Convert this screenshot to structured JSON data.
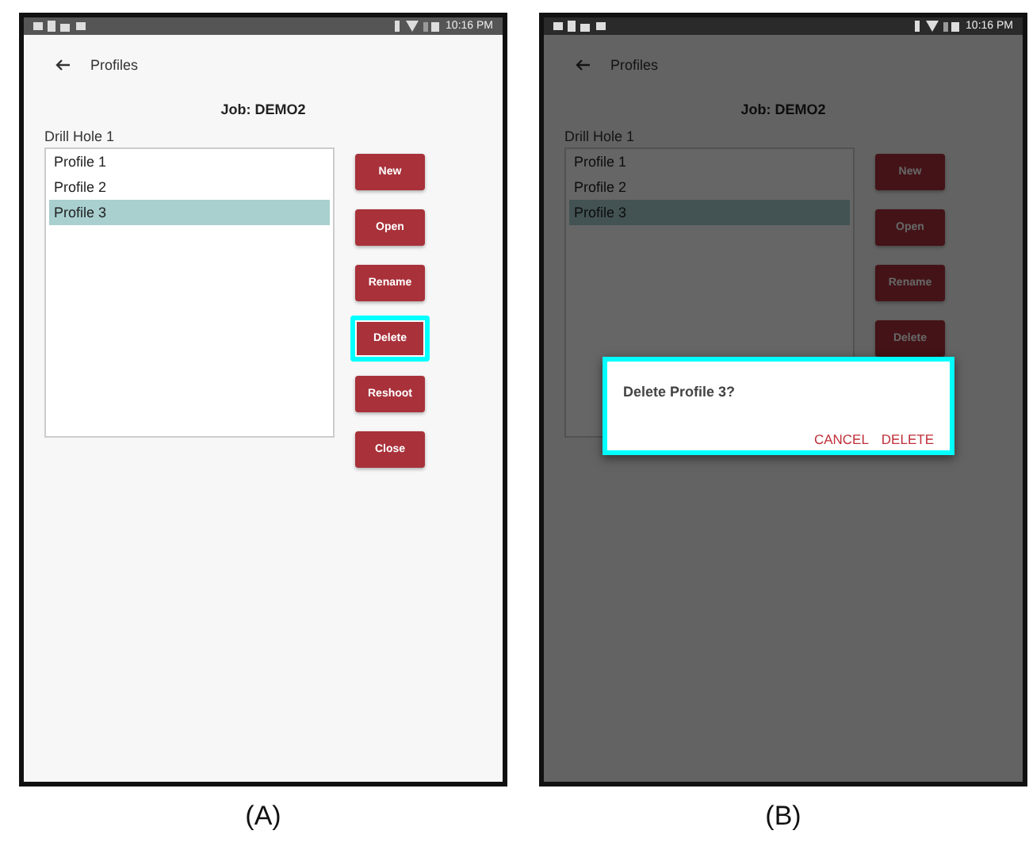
{
  "panels": [
    {
      "caption": "(A)",
      "dimmed": false,
      "status_bar": {
        "time": "10:16 PM"
      },
      "app_bar": {
        "title": "Profiles"
      },
      "job": "Job: DEMO2",
      "list_label": "Drill Hole 1",
      "profiles": [
        {
          "label": "Profile 1",
          "selected": false
        },
        {
          "label": "Profile 2",
          "selected": false
        },
        {
          "label": "Profile 3",
          "selected": true
        }
      ],
      "buttons": [
        {
          "label": "New",
          "highlighted": false
        },
        {
          "label": "Open",
          "highlighted": false
        },
        {
          "label": "Rename",
          "highlighted": false
        },
        {
          "label": "Delete",
          "highlighted": true
        },
        {
          "label": "Reshoot",
          "highlighted": false
        },
        {
          "label": "Close",
          "highlighted": false
        }
      ]
    },
    {
      "caption": "(B)",
      "dimmed": true,
      "status_bar": {
        "time": "10:16 PM"
      },
      "app_bar": {
        "title": "Profiles"
      },
      "job": "Job: DEMO2",
      "list_label": "Drill Hole 1",
      "profiles": [
        {
          "label": "Profile 1",
          "selected": false
        },
        {
          "label": "Profile 2",
          "selected": false
        },
        {
          "label": "Profile 3",
          "selected": true
        }
      ],
      "buttons": [
        {
          "label": "New",
          "highlighted": false
        },
        {
          "label": "Open",
          "highlighted": false
        },
        {
          "label": "Rename",
          "highlighted": false
        },
        {
          "label": "Delete",
          "highlighted": false
        }
      ],
      "dialog": {
        "message": "Delete Profile 3?",
        "highlighted": true,
        "actions": [
          "CANCEL",
          "DELETE"
        ]
      }
    }
  ]
}
